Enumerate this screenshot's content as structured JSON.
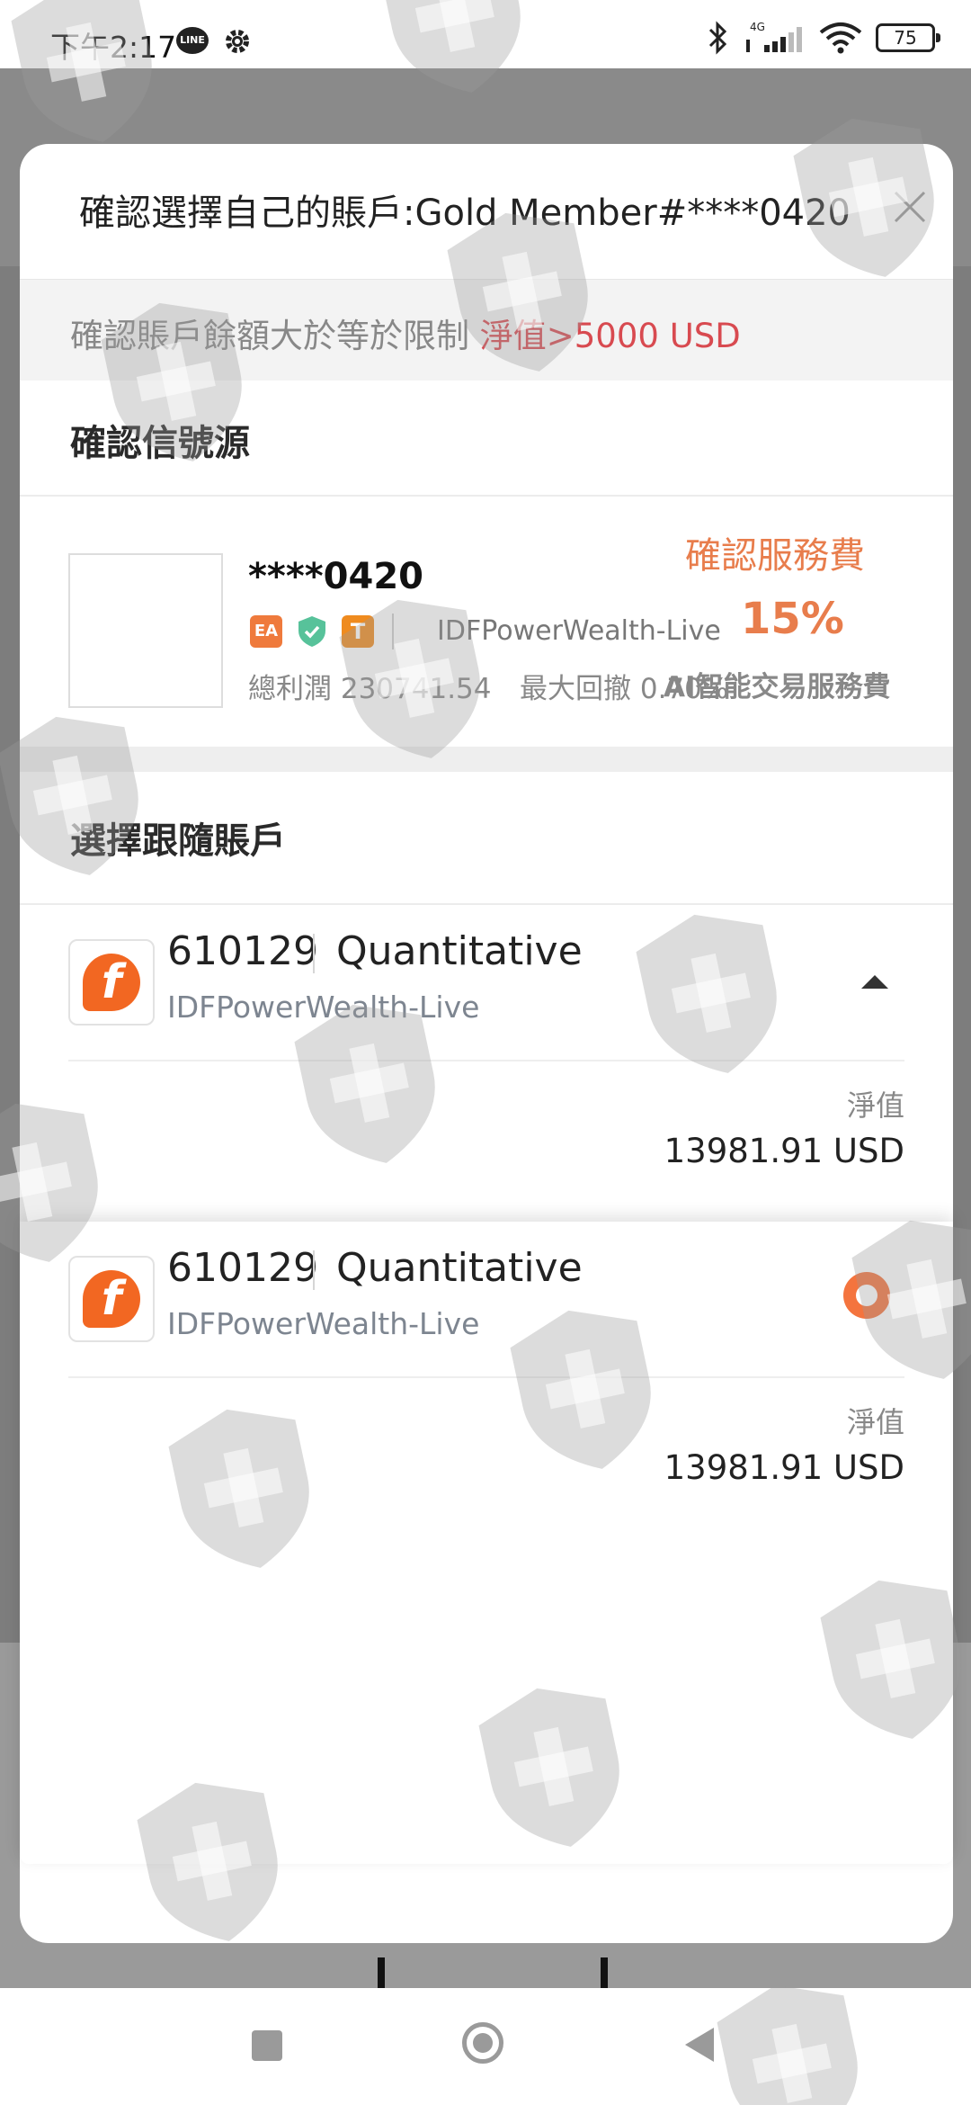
{
  "status_bar": {
    "time": "下午2:17",
    "line_badge": "LINE",
    "network": "4G",
    "battery": "75"
  },
  "dialog": {
    "title": "確認選擇自己的賬戶:Gold Member#****0420",
    "limit_label": "確認賬戶餘額大於等於限制",
    "limit_value": "淨值>5000 USD",
    "signal_section": "確認信號源",
    "signal": {
      "name": "****0420",
      "tags": [
        "EA",
        "T"
      ],
      "server": "IDFPowerWealth-Live",
      "profit": "總利潤 230741.54",
      "drawdown": "最大回撤 0.70%",
      "fee_label": "確認服務費",
      "fee_value": "15%",
      "fee_desc": "AI智能交易服務費"
    },
    "follow_section": "選擇跟隨賬戶",
    "accounts": [
      {
        "id": "610129",
        "type": "Quantitative",
        "server": "IDFPowerWealth-Live",
        "equity_label": "淨值",
        "equity_value": "13981.91 USD"
      }
    ]
  },
  "popup": {
    "account": {
      "id": "610129",
      "type": "Quantitative",
      "server": "IDFPowerWealth-Live",
      "equity_label": "淨值",
      "equity_value": "13981.91 USD"
    }
  },
  "colors": {
    "accent": "#f26722",
    "limit_red": "#d84a50",
    "fee_orange": "#e87d4c"
  },
  "icons": [
    "gear-icon",
    "bluetooth-icon",
    "signal-icon",
    "wifi-icon",
    "close-icon",
    "shield-check-icon",
    "caret-up-icon",
    "radio-selected-icon",
    "shield-cross-watermark"
  ]
}
